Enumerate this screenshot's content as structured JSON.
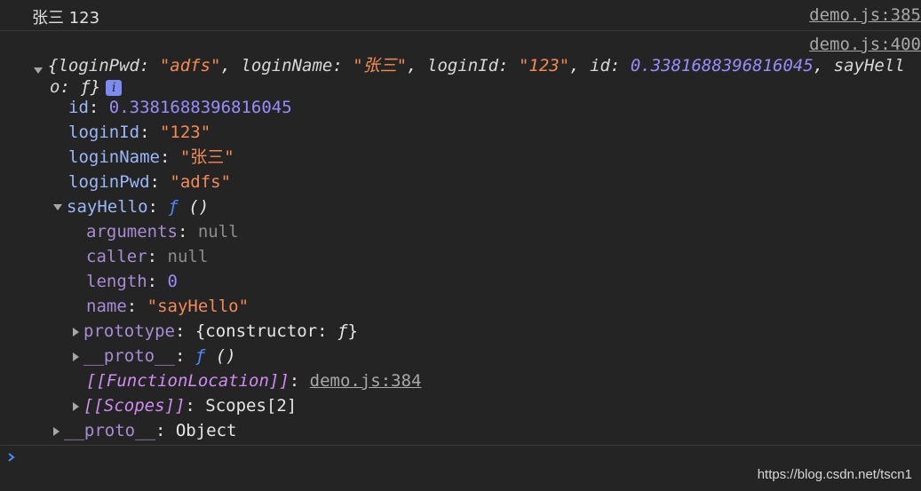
{
  "messages": [
    {
      "text": "张三 123",
      "source": "demo.js:385"
    },
    {
      "source": "demo.js:400",
      "preview": {
        "open": "{",
        "k1": "loginPwd",
        "v1": "\"adfs\"",
        "k2": "loginName",
        "v2": "\"张三\"",
        "k3": "loginId",
        "v3": "\"123\"",
        "k4": "id",
        "v4": "0.3381688396816045",
        "k5_part1": "sayHell",
        "k5_part2": "o",
        "v5": "ƒ",
        "close": "}",
        "info": "i"
      },
      "props": {
        "id": {
          "key": "id",
          "value": "0.3381688396816045"
        },
        "loginId": {
          "key": "loginId",
          "value": "\"123\""
        },
        "loginName": {
          "key": "loginName",
          "value": "\"张三\""
        },
        "loginPwd": {
          "key": "loginPwd",
          "value": "\"adfs\""
        },
        "sayHello": {
          "key": "sayHello",
          "value_f": "ƒ",
          "value_parens": "()",
          "children": {
            "arguments": {
              "key": "arguments",
              "value": "null"
            },
            "caller": {
              "key": "caller",
              "value": "null"
            },
            "length": {
              "key": "length",
              "value": "0"
            },
            "name": {
              "key": "name",
              "value": "\"sayHello\""
            },
            "prototype": {
              "key": "prototype",
              "value_open": "{constructor: ",
              "value_f": "ƒ",
              "value_close": "}"
            },
            "proto_fn": {
              "key": "__proto__",
              "value_f": "ƒ",
              "value_parens": "()"
            },
            "function_location": {
              "key": "[[FunctionLocation]]",
              "value": "demo.js:384"
            },
            "scopes": {
              "key": "[[Scopes]]",
              "value": "Scopes[2]"
            }
          }
        },
        "proto": {
          "key": "__proto__",
          "value": "Object"
        }
      }
    }
  ],
  "separator": ": ",
  "comma": ", ",
  "watermark": "https://blog.csdn.net/tscn1",
  "colors": {
    "background": "#242424",
    "key": "#9ab7f8",
    "string": "#f28b54",
    "number": "#9a8cff",
    "null": "#8c8c8c",
    "function": "#4e8cff",
    "internal": "#d08cf0",
    "prompt": "#4e8cff"
  }
}
